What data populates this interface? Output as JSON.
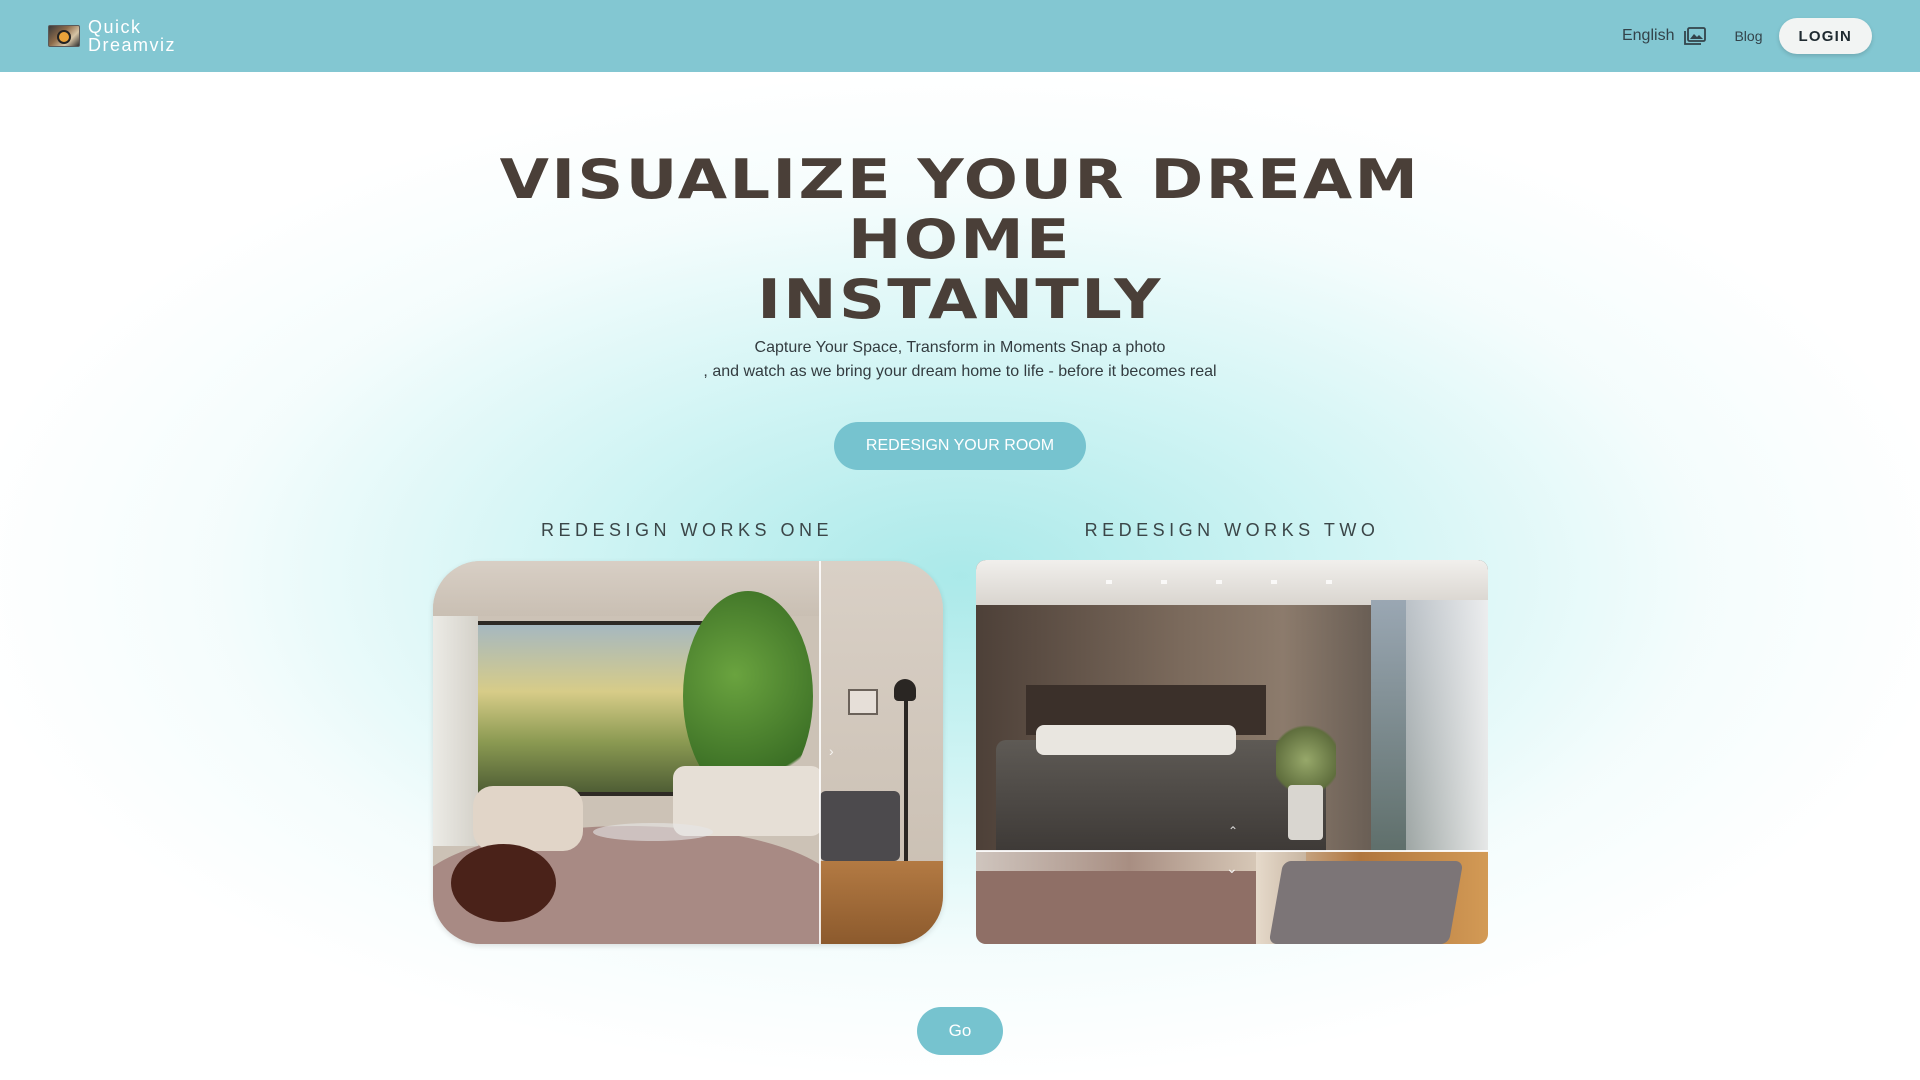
{
  "header": {
    "brand_line1": "Quick",
    "brand_line2": "Dreamviz",
    "language_label": "English",
    "language_icon": "image-stack-icon",
    "blog_label": "Blog",
    "login_label": "LOGIN",
    "bar_color": "#83c7d2"
  },
  "hero": {
    "title_lines": [
      "VISUALIZE YOUR DREAM",
      "HOME",
      "INSTANTLY"
    ],
    "subtitle_lines": [
      "Capture Your Space, Transform in Moments Snap a photo",
      ", and watch as we bring your dream home to life - before it becomes real"
    ],
    "cta_label": "REDESIGN YOUR ROOM",
    "title_color": "#4a3f38",
    "accent_color": "#76c3cf"
  },
  "works": {
    "one": {
      "title": "REDESIGN WORKS ONE",
      "handle_icon": "chevron-right-icon"
    },
    "two": {
      "title": "REDESIGN WORKS TWO",
      "handle_up_icon": "chevron-up-icon",
      "handle_down_icon": "chevron-down-icon"
    }
  },
  "footer": {
    "go_label": "Go"
  }
}
